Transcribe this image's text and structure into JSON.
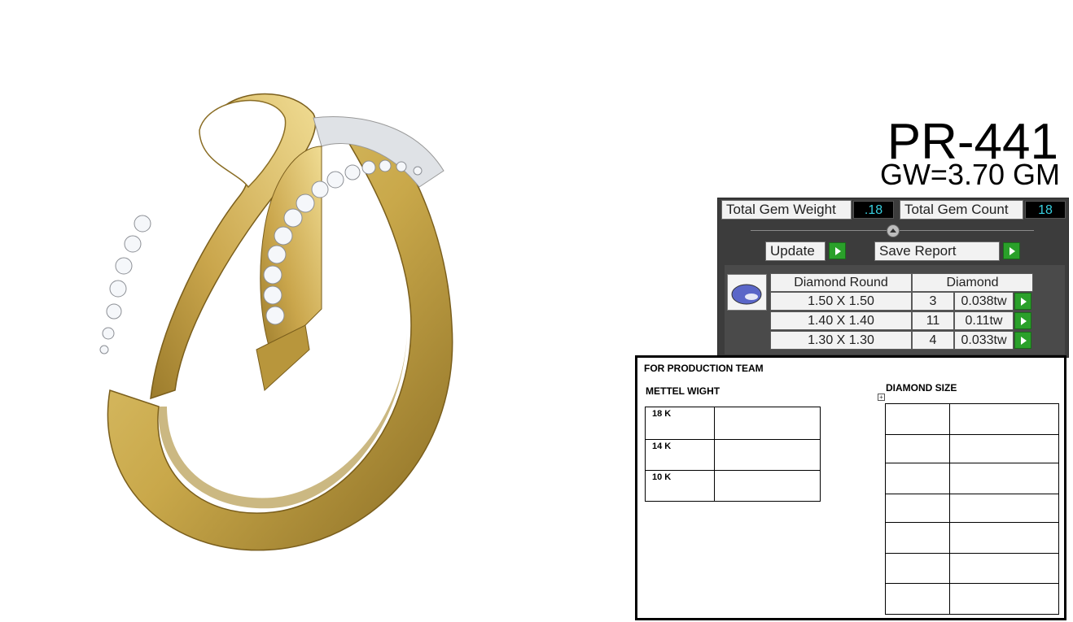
{
  "product": {
    "code": "PR-441",
    "gross_weight": "GW=3.70 GM"
  },
  "gem_panel": {
    "total_gem_weight_label": "Total Gem Weight",
    "total_gem_weight_value": ".18",
    "total_gem_count_label": "Total Gem Count",
    "total_gem_count_value": "18",
    "update_label": "Update",
    "save_report_label": "Save Report",
    "table": {
      "headers": [
        "Diamond Round",
        "Diamond"
      ],
      "rows": [
        {
          "size": "1.50 X 1.50",
          "count": "3",
          "weight": "0.038tw"
        },
        {
          "size": "1.40 X 1.40",
          "count": "11",
          "weight": "0.11tw"
        },
        {
          "size": "1.30 X 1.30",
          "count": "4",
          "weight": "0.033tw"
        }
      ]
    }
  },
  "sheet": {
    "title": "FOR PRODUCTION TEAM",
    "metal_heading": "METTEL WIGHT",
    "metal_rows": [
      "18 K",
      "14 K",
      "10 K"
    ],
    "diamond_heading": "DIAMOND SIZE",
    "move_handle_glyph": "+"
  },
  "colors": {
    "panel_bg": "#3c3c3c",
    "value_text": "#38d0e0",
    "button_green": "#2aa02a",
    "ring_gold": "#c9a84a"
  }
}
